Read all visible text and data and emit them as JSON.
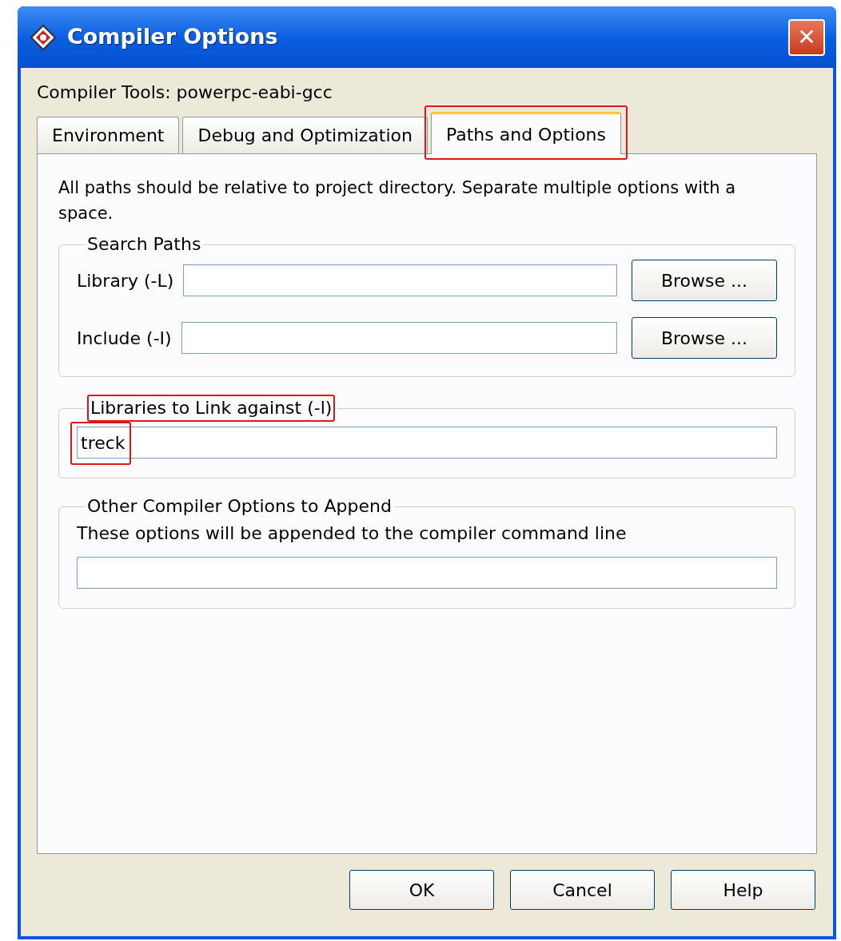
{
  "window": {
    "title": "Compiler Options",
    "close": "✕"
  },
  "compiler_tools": "Compiler Tools: powerpc-eabi-gcc",
  "tabs": [
    {
      "label": "Environment",
      "selected": false,
      "highlighted": false
    },
    {
      "label": "Debug and Optimization",
      "selected": false,
      "highlighted": false
    },
    {
      "label": "Paths and Options",
      "selected": true,
      "highlighted": true
    }
  ],
  "note": "All paths should be relative to project directory. Separate multiple options with a space.",
  "search_paths": {
    "label": "Search Paths",
    "highlighted": false,
    "rows": [
      {
        "label": "Library (-L)",
        "button": "Browse ..."
      },
      {
        "label": "Include (-I)",
        "button": "Browse ..."
      }
    ]
  },
  "libraries": {
    "label": "Libraries to Link against (-l)",
    "highlighted": true,
    "value": "treck",
    "value_highlighted": true
  },
  "other_options": {
    "label": "Other Compiler Options to Append",
    "highlighted": false,
    "description": "These options will be appended to the compiler command line"
  },
  "buttons": [
    "OK",
    "Cancel",
    "Help"
  ]
}
